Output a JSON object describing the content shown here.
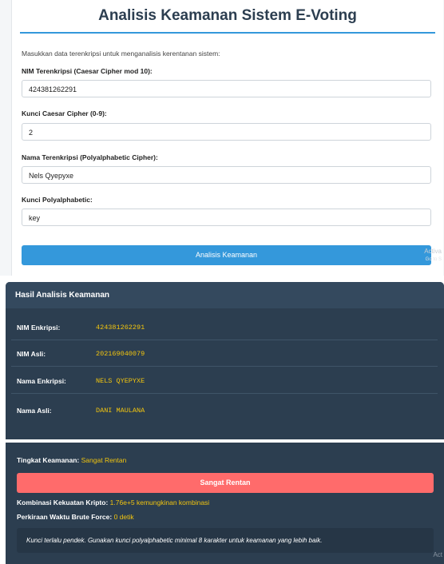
{
  "form": {
    "title": "Analisis Keamanan Sistem E-Voting",
    "intro": "Masukkan data terenkripsi untuk menganalisis kerentanan sistem:",
    "fields": [
      {
        "label": "NIM Terenkripsi (Caesar Cipher mod 10):",
        "value": "424381262291"
      },
      {
        "label": "Kunci Caesar Cipher (0-9):",
        "value": "2"
      },
      {
        "label": "Nama Terenkripsi (Polyalphabetic Cipher):",
        "value": "Nels Qyepyxe"
      },
      {
        "label": "Kunci Polyalphabetic:",
        "value": "key"
      }
    ],
    "analyze_button": "Analisis Keamanan"
  },
  "watermark": {
    "line1": "Activa",
    "line2": "Go to S",
    "line3": "Act"
  },
  "results": {
    "title": "Hasil Analisis Keamanan",
    "rows": [
      {
        "label": "NIM Enkripsi:",
        "value": "424381262291"
      },
      {
        "label": "NIM Asli:",
        "value": "202169040079"
      },
      {
        "label": "Nama Enkripsi:",
        "value": "NELS QYEPYXE"
      },
      {
        "label": "Nama Asli:",
        "value": "DANI MAULANA"
      }
    ]
  },
  "security": {
    "level_label": "Tingkat Keamanan:",
    "level_value": "Sangat Rentan",
    "badge": "Sangat Rentan",
    "strength_label": "Kombinasi Kekuatan Kripto:",
    "strength_value": "1.76e+5 kemungkinan kombinasi",
    "bruteforce_label": "Perkiraan Waktu Brute Force:",
    "bruteforce_value": "0 detik",
    "note": "Kunci terlalu pendek. Gunakan kunci polyalphabetic minimal 8 karakter untuk keamanan yang lebih baik."
  },
  "colors": {
    "accent": "#3498db",
    "panel": "#2c3e50",
    "danger": "#ff6b6b",
    "highlight": "#f1c40f"
  }
}
